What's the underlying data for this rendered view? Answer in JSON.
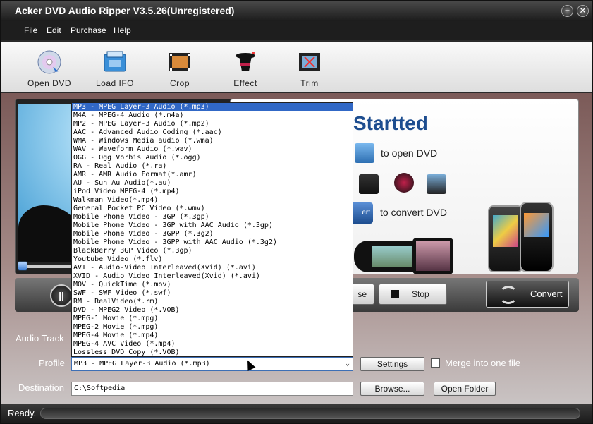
{
  "window": {
    "title": "Acker DVD Audio Ripper V3.5.26(Unregistered)",
    "minimize": "−",
    "close": "✕"
  },
  "menu": [
    "File",
    "Edit",
    "Purchase",
    "Help"
  ],
  "toolbar": [
    {
      "label": "Open DVD",
      "icon": "dvd-disc-icon"
    },
    {
      "label": "Load IFO",
      "icon": "folder-icon"
    },
    {
      "label": "Crop",
      "icon": "film-crop-icon"
    },
    {
      "label": "Effect",
      "icon": "magic-hat-icon"
    },
    {
      "label": "Trim",
      "icon": "film-scissors-icon"
    }
  ],
  "getting_started": {
    "title": "Startted",
    "open_text": "to open DVD",
    "convert_text": "to convert DVD",
    "convert_btn_fragment": "ert"
  },
  "player": {
    "pause_fragment": "se",
    "stop": "Stop",
    "convert": "Convert"
  },
  "form": {
    "audio_track_label": "Audio Track",
    "profile_label": "Profile",
    "profile_value": "MP3 - MPEG Layer-3 Audio (*.mp3)",
    "destination_label": "Destination",
    "destination_value": "C:\\Softpedia",
    "settings": "Settings",
    "merge_label": "Merge into one file",
    "browse": "Browse...",
    "open_folder": "Open Folder"
  },
  "profile_options": [
    "MP3 - MPEG Layer-3 Audio (*.mp3)",
    "M4A - MPEG-4 Audio (*.m4a)",
    "MP2 - MPEG Layer-3 Audio (*.mp2)",
    "AAC - Advanced Audio Coding (*.aac)",
    "WMA - Windows Media audio (*.wma)",
    "WAV - Waveform Audio (*.wav)",
    "OGG - Ogg Vorbis Audio (*.ogg)",
    "RA - Real Audio (*.ra)",
    "AMR - AMR Audio Format(*.amr)",
    "AU - Sun Au Audio(*.au)",
    "iPod Video MPEG-4 (*.mp4)",
    "Walkman Video(*.mp4)",
    "General Pocket PC Video (*.wmv)",
    "Mobile Phone Video - 3GP (*.3gp)",
    "Mobile Phone Video - 3GP with AAC Audio (*.3gp)",
    "Mobile Phone Video - 3GPP (*.3g2)",
    "Mobile Phone Video - 3GPP with AAC Audio (*.3g2)",
    "BlackBerry 3GP Video (*.3gp)",
    "Youtube Video (*.flv)",
    "AVI - Audio-Video Interleaved(Xvid) (*.avi)",
    "XVID - Audio Video Interleaved(Xvid) (*.avi)",
    "MOV - QuickTime (*.mov)",
    "SWF - SWF Video (*.swf)",
    "RM - RealVideo(*.rm)",
    "DVD - MPEG2 Video  (*.VOB)",
    "MPEG-1 Movie (*.mpg)",
    "MPEG-2 Movie (*.mpg)",
    "MPEG-4 Movie (*.mp4)",
    "MPEG-4 AVC Video (*.mp4)",
    "Lossless DVD Copy (*.VOB)"
  ],
  "selected_option_index": 0,
  "status": "Ready.",
  "colors": {
    "selection": "#3168c6",
    "title_accent": "#1d4d8f"
  }
}
